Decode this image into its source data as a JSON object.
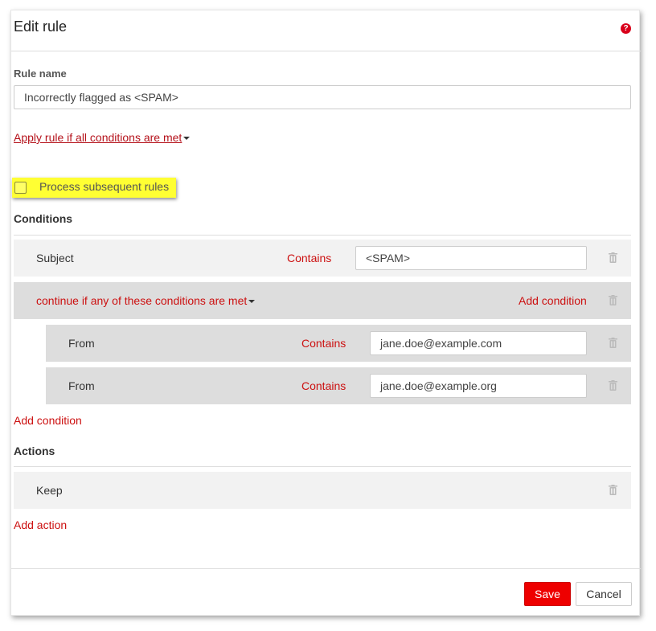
{
  "dialog": {
    "title": "Edit rule",
    "help_icon": "question-circle-icon"
  },
  "rule_name": {
    "label": "Rule name",
    "value": "Incorrectly flagged as <SPAM>"
  },
  "apply_mode": "Apply rule if all conditions are met",
  "process_subsequent": {
    "label": "Process subsequent rules",
    "checked": false,
    "highlight_color": "#ffff33"
  },
  "conditions": {
    "heading": "Conditions",
    "subject_row": {
      "field": "Subject",
      "operator": "Contains",
      "value": "<SPAM>"
    },
    "group": {
      "mode": "continue if any of these conditions are met",
      "add_condition": "Add condition",
      "rows": [
        {
          "field": "From",
          "operator": "Contains",
          "value": "jane.doe@example.com"
        },
        {
          "field": "From",
          "operator": "Contains",
          "value": "jane.doe@example.org"
        }
      ]
    },
    "add_condition": "Add condition"
  },
  "actions": {
    "heading": "Actions",
    "rows": [
      {
        "action": "Keep"
      }
    ],
    "add_action": "Add action"
  },
  "footer": {
    "save": "Save",
    "cancel": "Cancel"
  },
  "colors": {
    "accent_red": "#cc1010",
    "save_button": "#ee0000",
    "row_light": "#f2f2f2",
    "row_dark": "#dddddd"
  },
  "icons": {
    "trash": "trash-icon",
    "dropdown": "caret-down-icon"
  }
}
